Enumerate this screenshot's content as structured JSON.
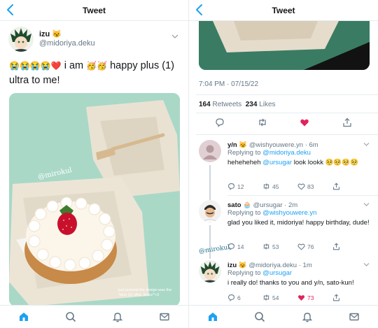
{
  "left": {
    "header_title": "Tweet",
    "author": {
      "name": "izu 😼",
      "handle": "@midoriya.deku"
    },
    "tweet": {
      "emojis": "😭😭😭😭❤️",
      "text_a": " i am ",
      "emojis2": "🥳🥳",
      "text_b": " happy plus (1) ultra to me!"
    },
    "photo": {
      "watermark": "@mirokul",
      "caption": "just pretend the design was the \"plus (1) ultra, izuku!\"<3"
    }
  },
  "right": {
    "header_title": "Tweet",
    "timestamp": "7:04 PM · 07/15/22",
    "stats": {
      "retweets": "164",
      "retweets_label": "Retweets",
      "likes": "234",
      "likes_label": "Likes"
    },
    "replies": [
      {
        "name": "y/n 😼",
        "handle": "@wishyouwere.yn · 6m",
        "replying_to_label": "Replying to ",
        "replying_to": "@midoriya.deku",
        "text_a": "heheheheh ",
        "mention": "@ursugar",
        "text_b": " look lookk 🥺🥺🥺🥺",
        "counts": {
          "replies": "12",
          "retweets": "45",
          "likes": "83"
        }
      },
      {
        "name": "sato 🧁",
        "handle": "@ursugar · 2m",
        "replying_to_label": "Replying to ",
        "replying_to": "@wishyouwere.yn",
        "text": "glad you liked it, midoriya! happy birthday, dude!",
        "counts": {
          "replies": "14",
          "retweets": "53",
          "likes": "76"
        }
      },
      {
        "name": "izu 😼",
        "handle": "@midoriya.deku · 1m",
        "replying_to_label": "Replying to ",
        "replying_to": "@ursugar",
        "text": "i really do! thanks to you and y/n, sato-kun!",
        "counts": {
          "replies": "6",
          "retweets": "54",
          "likes": "73"
        }
      }
    ],
    "watermark": "@mirokul"
  },
  "colors": {
    "accent": "#1da1f2",
    "like": "#e0245e",
    "muted": "#657786"
  }
}
